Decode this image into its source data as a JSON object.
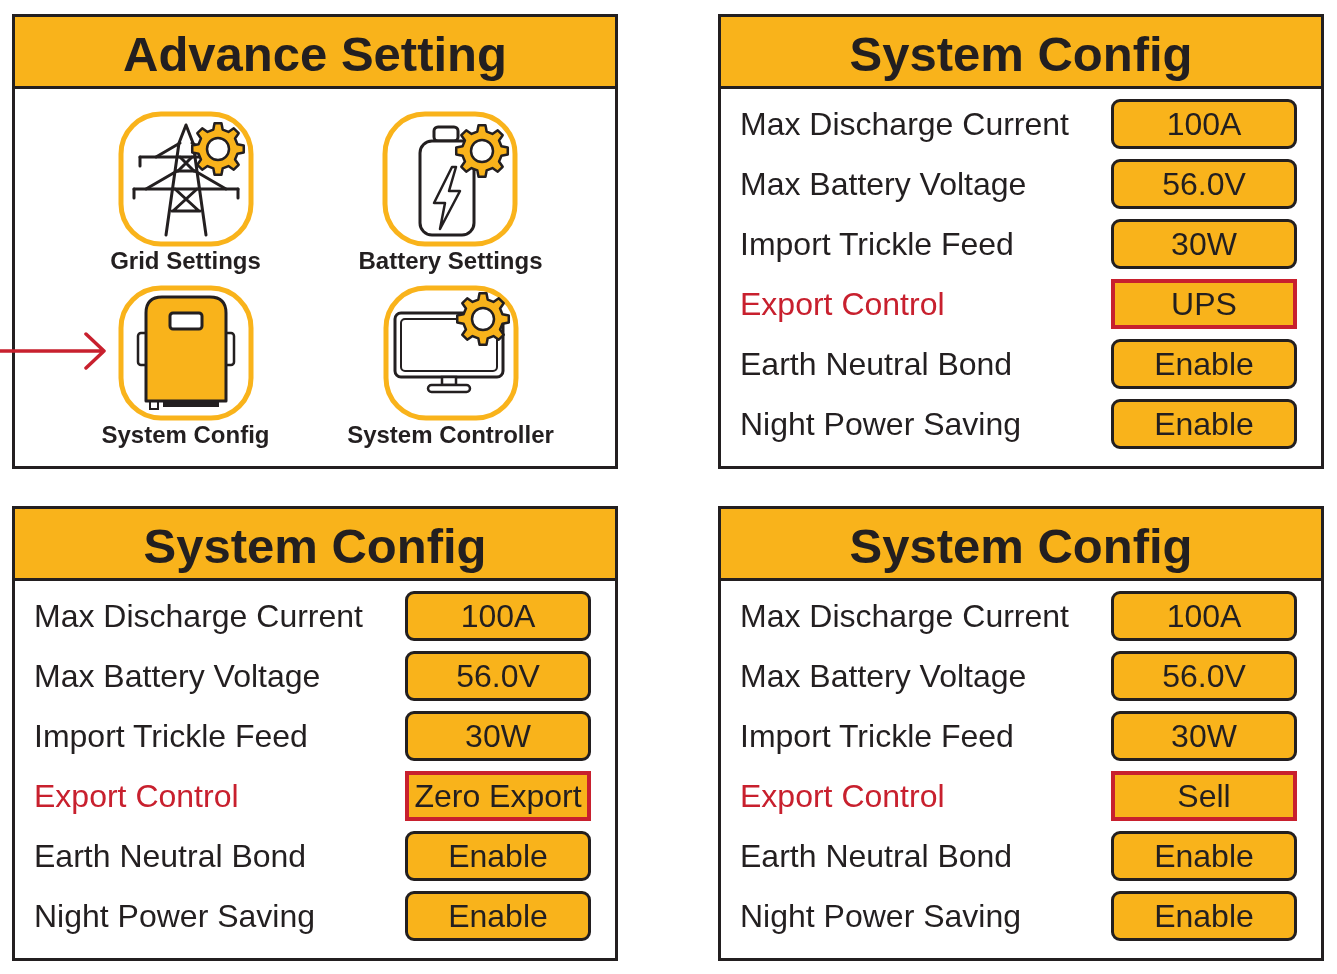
{
  "panels": [
    {
      "kind": "menu",
      "title": "Advance Setting",
      "items": [
        {
          "kind": "tower",
          "label": "Grid Settings",
          "selected": false
        },
        {
          "kind": "battery",
          "label": "Battery Settings",
          "selected": false
        },
        {
          "kind": "device",
          "label": "System Config",
          "selected": true
        },
        {
          "kind": "monitor",
          "label": "System Controller",
          "selected": false
        }
      ]
    },
    {
      "kind": "config",
      "title": "System Config",
      "rows": [
        {
          "label": "Max Discharge Current",
          "value": "100A",
          "highlighted": false
        },
        {
          "label": "Max Battery Voltage",
          "value": "56.0V",
          "highlighted": false
        },
        {
          "label": "Import Trickle Feed",
          "value": "30W",
          "highlighted": false
        },
        {
          "label": "Export Control",
          "value": "UPS",
          "highlighted": true
        },
        {
          "label": "Earth Neutral Bond",
          "value": "Enable",
          "highlighted": false
        },
        {
          "label": "Night Power Saving",
          "value": "Enable",
          "highlighted": false
        }
      ]
    },
    {
      "kind": "config",
      "title": "System Config",
      "rows": [
        {
          "label": "Max Discharge Current",
          "value": "100A",
          "highlighted": false
        },
        {
          "label": "Max Battery Voltage",
          "value": "56.0V",
          "highlighted": false
        },
        {
          "label": "Import Trickle Feed",
          "value": "30W",
          "highlighted": false
        },
        {
          "label": "Export Control",
          "value": "Zero Export",
          "highlighted": true
        },
        {
          "label": "Earth Neutral Bond",
          "value": "Enable",
          "highlighted": false
        },
        {
          "label": "Night Power Saving",
          "value": "Enable",
          "highlighted": false
        }
      ]
    },
    {
      "kind": "config",
      "title": "System Config",
      "rows": [
        {
          "label": "Max Discharge Current",
          "value": "100A",
          "highlighted": false
        },
        {
          "label": "Max Battery Voltage",
          "value": "56.0V",
          "highlighted": false
        },
        {
          "label": "Import Trickle Feed",
          "value": "30W",
          "highlighted": false
        },
        {
          "label": "Export Control",
          "value": "Sell",
          "highlighted": true
        },
        {
          "label": "Earth Neutral Bond",
          "value": "Enable",
          "highlighted": false
        },
        {
          "label": "Night Power Saving",
          "value": "Enable",
          "highlighted": false
        }
      ]
    }
  ]
}
